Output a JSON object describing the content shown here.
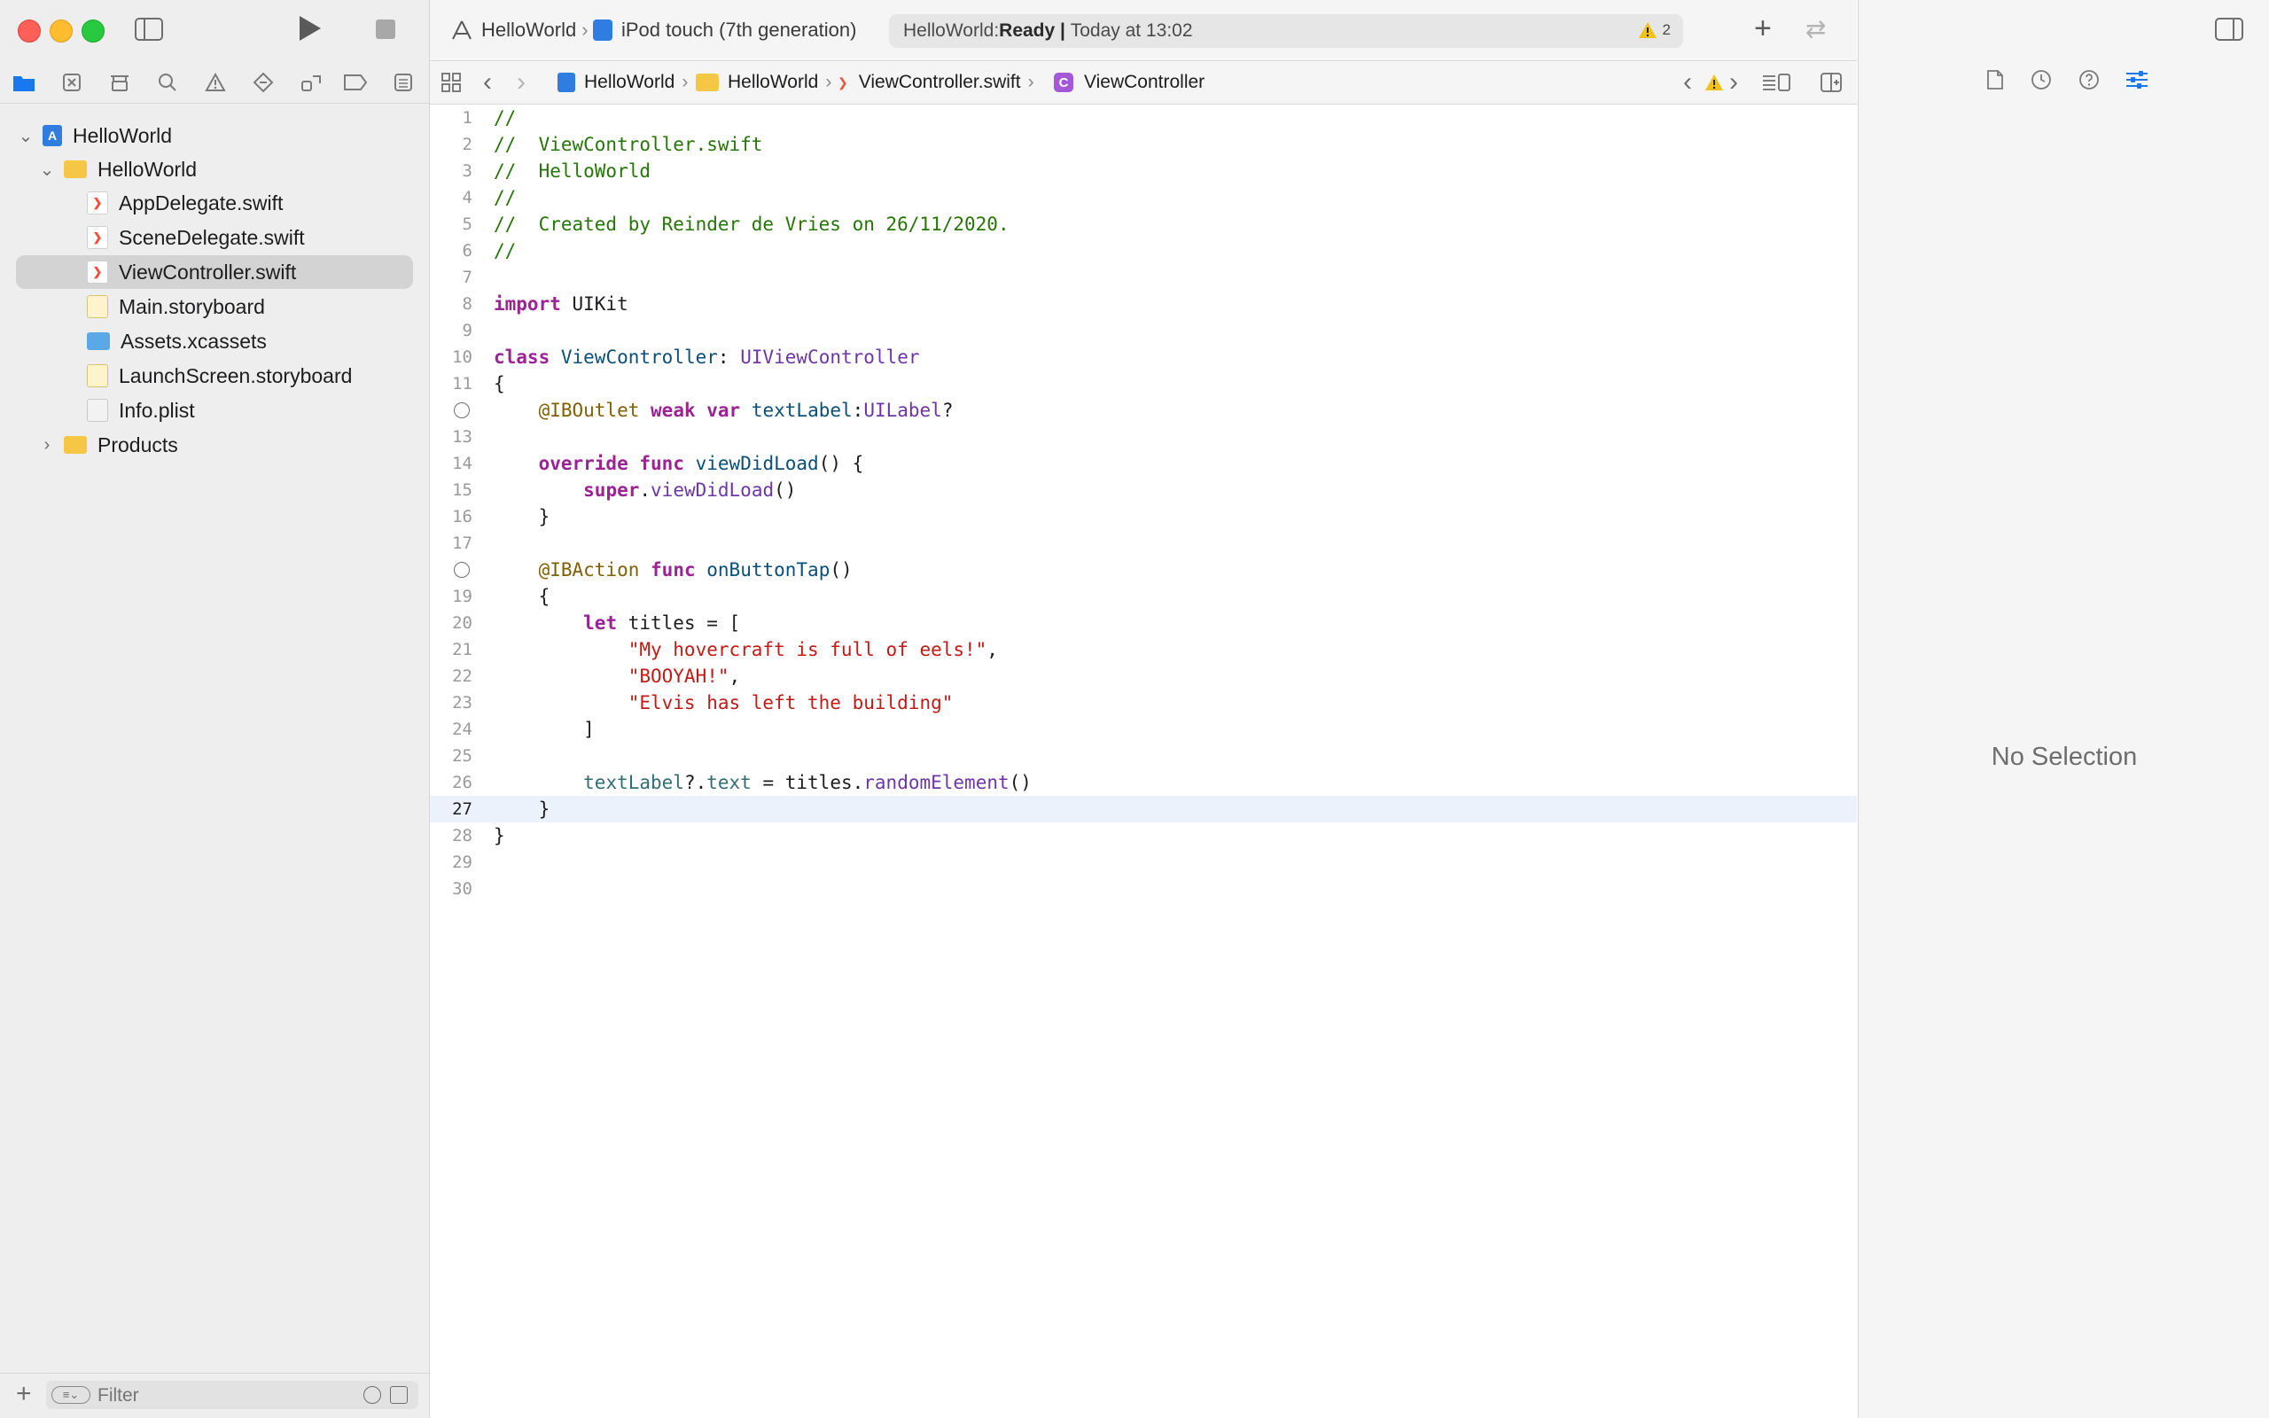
{
  "toolbar": {
    "scheme": "HelloWorld",
    "destination": "iPod touch (7th generation)",
    "status_prefix": "HelloWorld: ",
    "status_state": "Ready",
    "status_sep": " | ",
    "status_time": "Today at 13:02",
    "warning_count": "2"
  },
  "jumpbar": {
    "project": "HelloWorld",
    "group": "HelloWorld",
    "file": "ViewController.swift",
    "symbol": "ViewController",
    "symbol_badge": "C"
  },
  "navigator": {
    "items": [
      {
        "label": "HelloWorld",
        "kind": "project"
      },
      {
        "label": "HelloWorld",
        "kind": "folder"
      },
      {
        "label": "AppDelegate.swift",
        "kind": "swift"
      },
      {
        "label": "SceneDelegate.swift",
        "kind": "swift"
      },
      {
        "label": "ViewController.swift",
        "kind": "swift"
      },
      {
        "label": "Main.storyboard",
        "kind": "storyboard"
      },
      {
        "label": "Assets.xcassets",
        "kind": "assets"
      },
      {
        "label": "LaunchScreen.storyboard",
        "kind": "storyboard"
      },
      {
        "label": "Info.plist",
        "kind": "plist"
      },
      {
        "label": "Products",
        "kind": "folder"
      }
    ],
    "filter_placeholder": "Filter"
  },
  "editor": {
    "current_line": 27,
    "lines": [
      [
        [
          "c-cmt",
          "//"
        ]
      ],
      [
        [
          "c-cmt",
          "//  ViewController.swift"
        ]
      ],
      [
        [
          "c-cmt",
          "//  HelloWorld"
        ]
      ],
      [
        [
          "c-cmt",
          "//"
        ]
      ],
      [
        [
          "c-cmt",
          "//  Created by Reinder de Vries on 26/11/2020."
        ]
      ],
      [
        [
          "c-cmt",
          "//"
        ]
      ],
      [],
      [
        [
          "c-kw",
          "import"
        ],
        [
          "c-plain",
          " UIKit"
        ]
      ],
      [],
      [
        [
          "c-kw",
          "class"
        ],
        [
          "c-plain",
          " "
        ],
        [
          "c-type",
          "ViewController"
        ],
        [
          "c-plain",
          ": "
        ],
        [
          "c-sys",
          "UIViewController"
        ]
      ],
      [
        [
          "c-plain",
          "{"
        ]
      ],
      [
        [
          "c-plain",
          "    "
        ],
        [
          "c-attr",
          "@IBOutlet"
        ],
        [
          "c-plain",
          " "
        ],
        [
          "c-kw",
          "weak"
        ],
        [
          "c-plain",
          " "
        ],
        [
          "c-kw",
          "var"
        ],
        [
          "c-plain",
          " "
        ],
        [
          "c-type",
          "textLabel"
        ],
        [
          "c-plain",
          ":"
        ],
        [
          "c-sys",
          "UILabel"
        ],
        [
          "c-plain",
          "?"
        ]
      ],
      [],
      [
        [
          "c-plain",
          "    "
        ],
        [
          "c-kw",
          "override"
        ],
        [
          "c-plain",
          " "
        ],
        [
          "c-kw",
          "func"
        ],
        [
          "c-plain",
          " "
        ],
        [
          "c-type",
          "viewDidLoad"
        ],
        [
          "c-plain",
          "() {"
        ]
      ],
      [
        [
          "c-plain",
          "        "
        ],
        [
          "c-kw",
          "super"
        ],
        [
          "c-plain",
          "."
        ],
        [
          "c-sys",
          "viewDidLoad"
        ],
        [
          "c-plain",
          "()"
        ]
      ],
      [
        [
          "c-plain",
          "    }"
        ]
      ],
      [],
      [
        [
          "c-plain",
          "    "
        ],
        [
          "c-attr",
          "@IBAction"
        ],
        [
          "c-plain",
          " "
        ],
        [
          "c-kw",
          "func"
        ],
        [
          "c-plain",
          " "
        ],
        [
          "c-type",
          "onButtonTap"
        ],
        [
          "c-plain",
          "()"
        ]
      ],
      [
        [
          "c-plain",
          "    {"
        ]
      ],
      [
        [
          "c-plain",
          "        "
        ],
        [
          "c-kw",
          "let"
        ],
        [
          "c-plain",
          " titles = ["
        ]
      ],
      [
        [
          "c-plain",
          "            "
        ],
        [
          "c-str",
          "\"My hovercraft is full of eels!\""
        ],
        [
          "c-plain",
          ","
        ]
      ],
      [
        [
          "c-plain",
          "            "
        ],
        [
          "c-str",
          "\"BOOYAH!\""
        ],
        [
          "c-plain",
          ","
        ]
      ],
      [
        [
          "c-plain",
          "            "
        ],
        [
          "c-str",
          "\"Elvis has left the building\""
        ]
      ],
      [
        [
          "c-plain",
          "        ]"
        ]
      ],
      [],
      [
        [
          "c-plain",
          "        "
        ],
        [
          "c-prop",
          "textLabel"
        ],
        [
          "c-plain",
          "?."
        ],
        [
          "c-prop",
          "text"
        ],
        [
          "c-plain",
          " = titles."
        ],
        [
          "c-sys",
          "randomElement"
        ],
        [
          "c-plain",
          "()"
        ]
      ],
      [
        [
          "c-plain",
          "    }"
        ]
      ],
      [
        [
          "c-plain",
          "}"
        ]
      ],
      [],
      []
    ],
    "outlet_lines": [
      12,
      18
    ]
  },
  "inspector": {
    "empty_label": "No Selection"
  }
}
